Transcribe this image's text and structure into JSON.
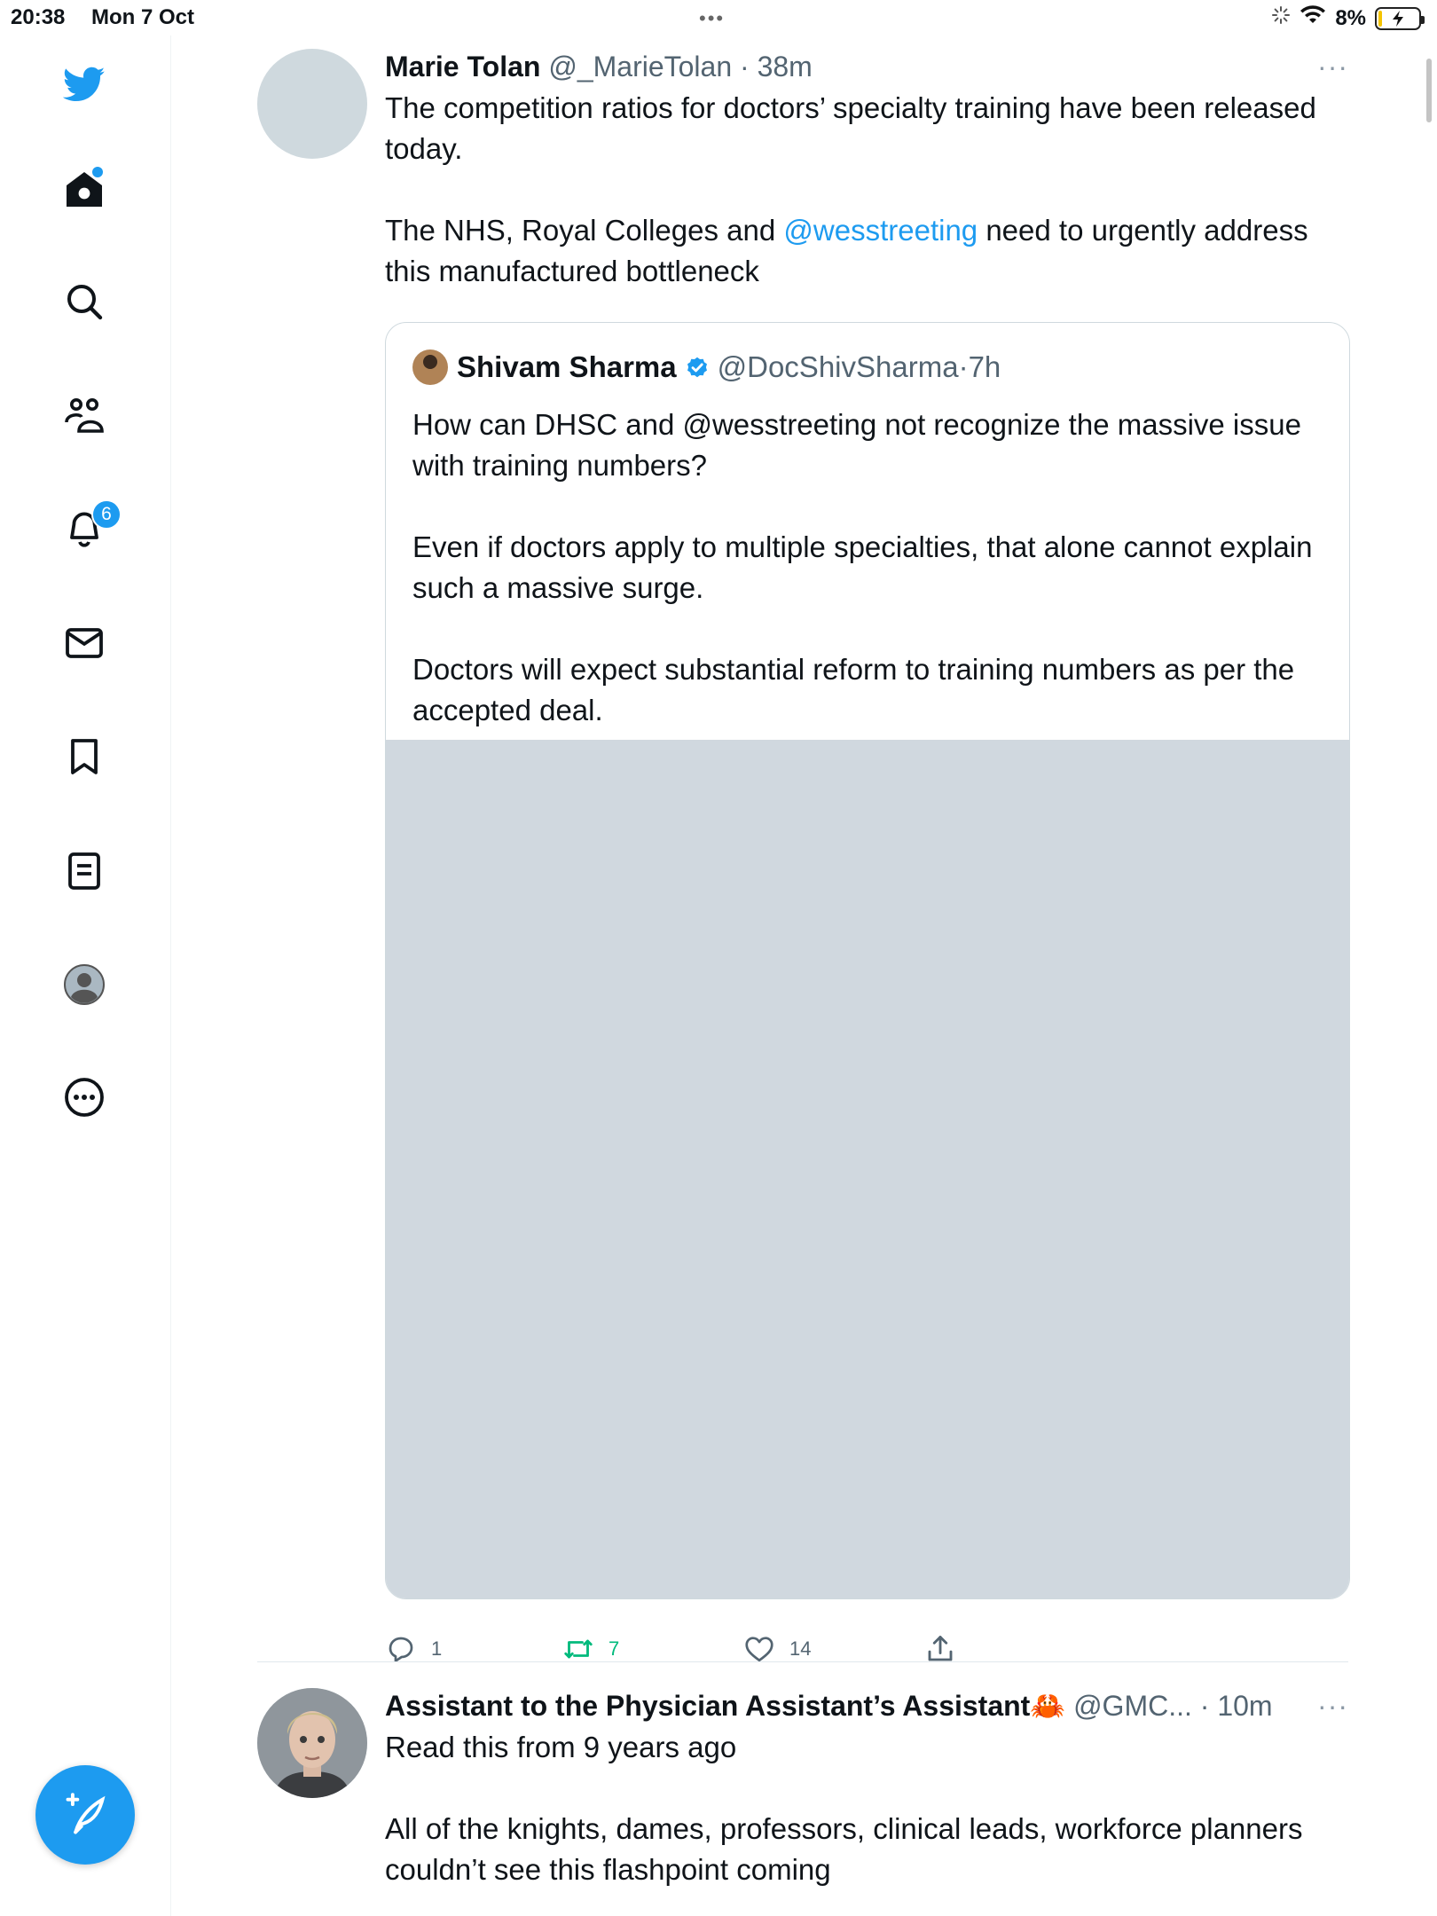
{
  "status_bar": {
    "time": "20:38",
    "date": "Mon 7 Oct",
    "battery": "8%",
    "battery_fraction": 0.08
  },
  "sidebar": {
    "items": [
      {
        "icon": "twitter-logo-icon"
      },
      {
        "icon": "home-icon",
        "has_new": true
      },
      {
        "icon": "search-icon"
      },
      {
        "icon": "communities-icon"
      },
      {
        "icon": "notifications-icon",
        "badge": "6"
      },
      {
        "icon": "messages-icon"
      },
      {
        "icon": "bookmarks-icon"
      },
      {
        "icon": "lists-icon"
      },
      {
        "icon": "profile-icon"
      },
      {
        "icon": "more-icon"
      }
    ],
    "compose": {
      "icon": "compose-feather-icon"
    }
  },
  "colors": {
    "accent": "#1d9bf0",
    "retweet": "#00ba7c",
    "muted": "#536471",
    "media_placeholder": "#d0d8df"
  },
  "tweets": [
    {
      "name": "Marie Tolan",
      "handle": "@_MarieTolan",
      "separator": "·",
      "time": "38m",
      "more": "···",
      "text_p1": "The competition ratios for doctors’ specialty training have been released today.",
      "text_p2_pre": "The NHS, Royal Colleges and ",
      "text_p2_mention": "@wesstreeting",
      "text_p2_post": " need to urgently address this manufactured bottleneck",
      "quote": {
        "name": "Shivam Sharma",
        "verified": true,
        "handle": "@DocShivSharma",
        "separator": "·",
        "time": "7h",
        "text": "How can DHSC and @wesstreeting not recognize the massive issue with training numbers?\n\nEven if doctors apply to multiple specialties, that alone cannot explain such a massive surge.\n\nDoctors will expect substantial reform to training numbers as per the accepted deal."
      },
      "actions": {
        "replies": "1",
        "retweets": "7",
        "likes": "14"
      }
    },
    {
      "name": "Assistant to the Physician Assistant’s Assistant🦀",
      "handle": "@GMC...",
      "separator": "·",
      "time": "10m",
      "more": "···",
      "text": "Read this from 9 years ago\n\nAll of the knights, dames, professors, clinical leads, workforce planners couldn’t see this flashpoint coming"
    }
  ]
}
